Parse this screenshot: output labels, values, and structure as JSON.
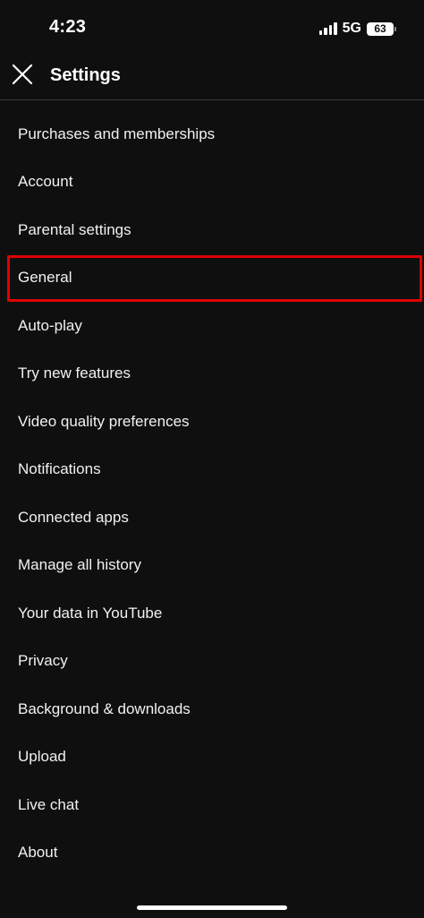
{
  "status_bar": {
    "time": "4:23",
    "network": "5G",
    "battery": "63"
  },
  "header": {
    "title": "Settings",
    "close_icon": "close-icon"
  },
  "settings": {
    "items": [
      {
        "label": "Purchases and memberships"
      },
      {
        "label": "Account"
      },
      {
        "label": "Parental settings"
      },
      {
        "label": "General",
        "highlighted": true
      },
      {
        "label": "Auto-play"
      },
      {
        "label": "Try new features"
      },
      {
        "label": "Video quality preferences"
      },
      {
        "label": "Notifications"
      },
      {
        "label": "Connected apps"
      },
      {
        "label": "Manage all history"
      },
      {
        "label": "Your data in YouTube"
      },
      {
        "label": "Privacy"
      },
      {
        "label": "Background & downloads"
      },
      {
        "label": "Upload"
      },
      {
        "label": "Live chat"
      },
      {
        "label": "About"
      }
    ]
  },
  "colors": {
    "background": "#0f0f0f",
    "text": "#f1f1f1",
    "highlight": "#e00000"
  }
}
